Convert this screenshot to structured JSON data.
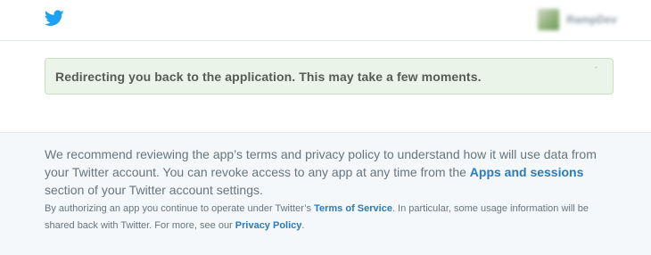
{
  "header": {
    "logo_icon": "twitter-bird-icon",
    "brand_color": "#1da1f2",
    "account": {
      "name": "RampDev",
      "avatar_icon": "account-avatar"
    }
  },
  "alert": {
    "message": "Redirecting you back to the application. This may take a few moments.",
    "dismiss_glyph": "ˊ"
  },
  "footer": {
    "lead": {
      "before_link": "We recommend reviewing the app’s terms and privacy policy to understand how it will use data from your Twitter account. You can revoke access to any app at any time from the ",
      "link": "Apps and sessions",
      "after_link": " section of your Twitter account settings."
    },
    "fine": {
      "part1": "By authorizing an app you continue to operate under Twitter’s ",
      "terms_link": "Terms of Service",
      "part2": ". In particular, some usage information will be shared back with Twitter. For more, see our ",
      "privacy_link": "Privacy Policy",
      "part3": "."
    }
  },
  "colors": {
    "link": "#2b7bb9",
    "alert_bg": "#ebf4e8",
    "alert_border": "#c8e0bf",
    "footer_bg": "#f5f8fa"
  }
}
